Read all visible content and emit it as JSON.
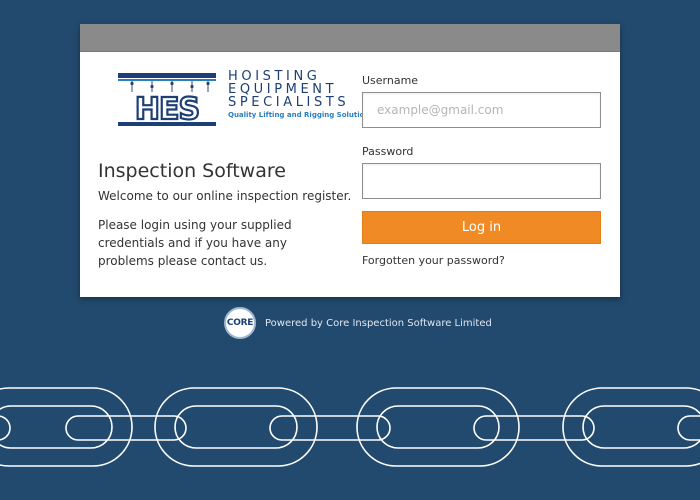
{
  "logo": {
    "letters": "HES",
    "line1": "HOISTING",
    "line2": "EQUIPMENT",
    "line3": "SPECIALISTS",
    "tagline": "Quality Lifting and Rigging Solutions"
  },
  "intro": {
    "title": "Inspection Software",
    "welcome": "Welcome to our online inspection register.",
    "instructions": "Please login using your supplied credentials and if you have any problems please contact us."
  },
  "form": {
    "username_label": "Username",
    "username_placeholder": "example@gmail.com",
    "username_value": "",
    "password_label": "Password",
    "password_value": "",
    "login_label": "Log in",
    "forgot_label": "Forgotten your password?"
  },
  "footer": {
    "badge": "CORE",
    "powered_by": "Powered by Core Inspection Software Limited"
  },
  "colors": {
    "background": "#22496e",
    "accent": "#f08a24",
    "header_bar": "#8a8a8a",
    "logo_blue": "#1d3f74",
    "logo_light_blue": "#2a7fc0"
  },
  "icons": {
    "logo": "hes-chain-logo",
    "badge": "core-circle-logo",
    "decoration": "chain-links"
  }
}
